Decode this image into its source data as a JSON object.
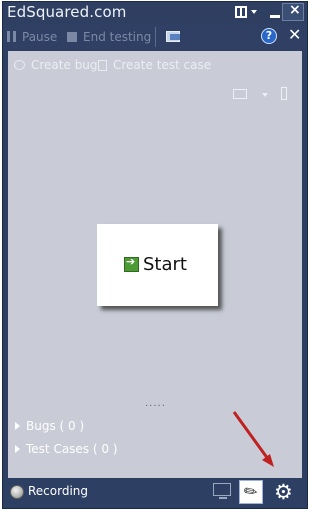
{
  "window": {
    "title": "EdSquared.com"
  },
  "toolbar": {
    "pause_label": "Pause",
    "end_testing_label": "End testing"
  },
  "subtoolbar": {
    "create_bug_label": "Create bug",
    "create_test_case_label": "Create test case"
  },
  "start": {
    "label": "Start"
  },
  "sections": {
    "bugs": "Bugs ( 0 )",
    "test_cases": "Test Cases ( 0 )"
  },
  "status": {
    "recording_label": "Recording"
  },
  "icons": {
    "help": "help-icon",
    "close": "close-icon",
    "layout": "layout-icon",
    "minimize": "minimize-icon",
    "folder": "folder-icon",
    "camera": "camera-icon",
    "pin": "pin-icon",
    "monitor": "monitor-icon",
    "attachment": "attachment-icon",
    "settings": "gear-icon"
  },
  "colors": {
    "window_bg": "#2e3f62",
    "content_bg": "#c9ccd7",
    "annotation_arrow": "#c0201f"
  }
}
